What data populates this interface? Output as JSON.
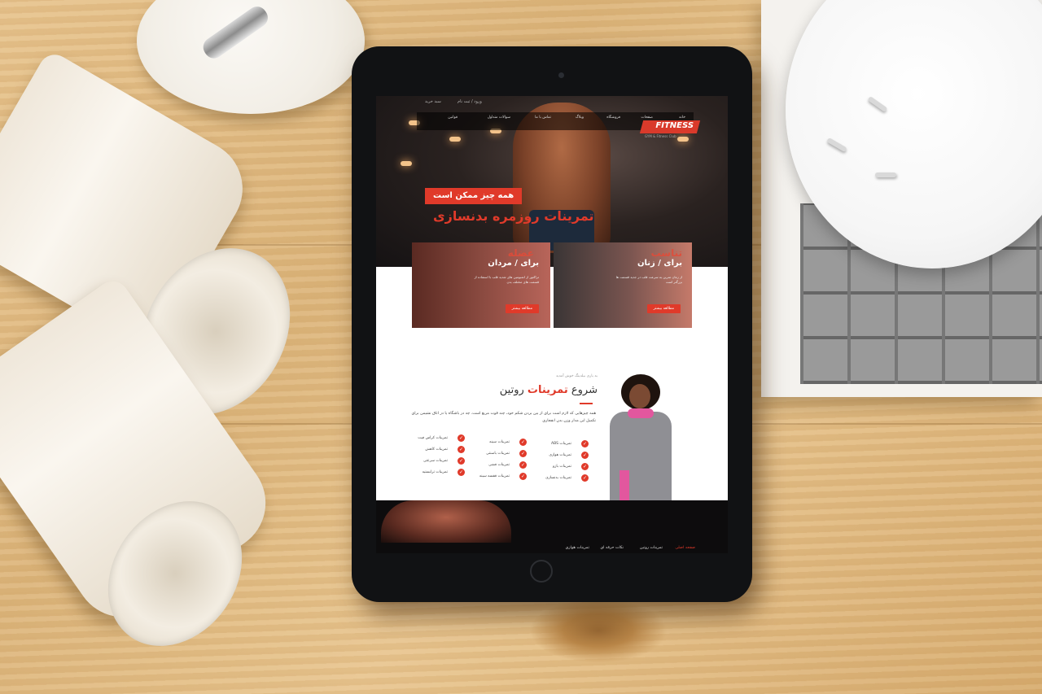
{
  "hero": {
    "top_links": [
      "ورود / ثبت نام",
      "سبد خرید"
    ],
    "nav_items": [
      "خانه",
      "صفحات",
      "فروشگاه",
      "وبلاگ",
      "تماس با ما",
      "سوالات متداول",
      "قوانین"
    ],
    "logo_text": "FITNESS",
    "logo_sub": "GYM & Fitness Club",
    "tag": "همه چیز ممکن است",
    "title": "تمرینات روزمره بدنسازی"
  },
  "cards": [
    {
      "accent": "عضله",
      "category": "برای / مردان",
      "description": "تراکتور از اتمبومین های شدید قلب با استفاده از قسمت های مختلف بدن",
      "button": "مطالعه بیشتر"
    },
    {
      "accent": "تناسب",
      "category": "برای / زنان",
      "description": "از زمان تمرین به سرعت قلب در جدید قسمت ها بزرگتر است",
      "button": "مطالعه بیشتر"
    }
  ],
  "routine": {
    "overline": "به یاری بیلدینگ خوش آمدید",
    "title_plain": "شروع",
    "title_accent": "تمرینات",
    "title_end": "روتین",
    "description": "همه چیزهایی که لازم است برای از بین بردن شکم خود، چند قوت مربع است. چه در باشگاه یا در اتاق نشیمن برای تکمیل این مدار وزن بدن انفجاری",
    "col1": [
      "تمرینات ABS",
      "تمرینات هوازی",
      "تمرینات بازو",
      "تمرینات بدنسازی"
    ],
    "col2": [
      "تمرینات سینه",
      "تمرینات باسنتی",
      "تمرینات فشی",
      "تمرینات قفسه سینه"
    ],
    "col3": [
      "تمرینات کراس فیت",
      "تمرینات کاهش",
      "تمرینات سرعتی",
      "تمرینات ترابستیه"
    ]
  },
  "bottom_nav": [
    "صفحه اصلی",
    "تمرینات روتین",
    "نکات حرفه ای",
    "تمرینات هوازی"
  ],
  "colors": {
    "accent": "#e03a2a",
    "tablet": "#111214",
    "wood": "#e0bb82"
  }
}
